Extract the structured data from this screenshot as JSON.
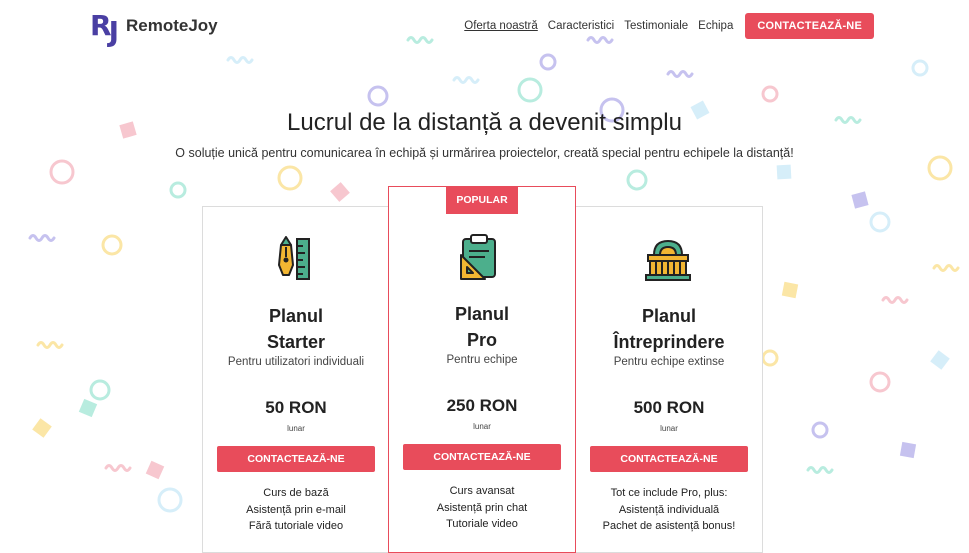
{
  "brand": {
    "mark": "RJ",
    "name": "RemoteJoy"
  },
  "nav": {
    "items": [
      "Oferta noastră",
      "Caracteristici",
      "Testimoniale",
      "Echipa"
    ],
    "cta": "CONTACTEAZĂ-NE"
  },
  "hero": {
    "title": "Lucrul de la distanță a devenit simplu",
    "subtitle": "O soluție unică pentru comunicarea în echipă și urmărirea proiectelor, creată special pentru echipele la distanță!"
  },
  "plans": [
    {
      "icon": "pen-ruler-icon",
      "name_line1": "Planul",
      "name_line2": "Starter",
      "subtitle": "Pentru utilizatori individuali",
      "price": "50 RON",
      "period": "lunar",
      "cta": "CONTACTEAZĂ-NE",
      "features": [
        "Curs de bază",
        "Asistență prin e-mail",
        "Fără tutoriale video"
      ]
    },
    {
      "badge": "POPULAR",
      "icon": "clipboard-ruler-icon",
      "name_line1": "Planul",
      "name_line2": "Pro",
      "subtitle": "Pentru echipe",
      "price": "250 RON",
      "period": "lunar",
      "cta": "CONTACTEAZĂ-NE",
      "features": [
        "Curs avansat",
        "Asistență prin chat",
        "Tutoriale video"
      ]
    },
    {
      "icon": "building-icon",
      "name_line1": "Planul",
      "name_line2": "Întreprindere",
      "subtitle": "Pentru echipe extinse",
      "price": "500 RON",
      "period": "lunar",
      "cta": "CONTACTEAZĂ-NE",
      "features": [
        "Tot ce include Pro, plus:",
        "Asistență individuală",
        "Pachet de asistență bonus!"
      ]
    }
  ],
  "colors": {
    "accent": "#e84c5b",
    "brand": "#4a3fa3",
    "confetti": [
      "#c6c2ef",
      "#b8ecdf",
      "#fbe6a6",
      "#f7c7cf",
      "#d6eef9"
    ]
  }
}
